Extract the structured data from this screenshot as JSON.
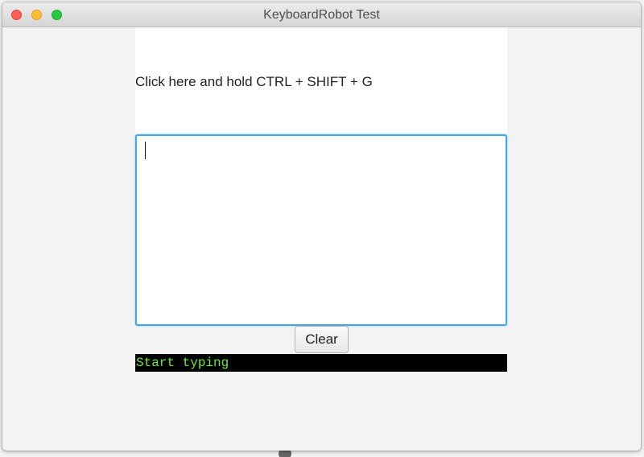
{
  "window": {
    "title": "KeyboardRobot Test"
  },
  "prompt": {
    "label": "Click here and hold CTRL + SHIFT + G"
  },
  "text_area": {
    "value": ""
  },
  "buttons": {
    "clear_label": "Clear"
  },
  "status": {
    "text": "Start typing"
  },
  "colors": {
    "focus_ring": "#3fa8e8",
    "status_background": "#000000",
    "status_text": "#66ee33",
    "close": "#fd5f57",
    "minimize": "#febc2e",
    "zoom": "#28c840"
  }
}
